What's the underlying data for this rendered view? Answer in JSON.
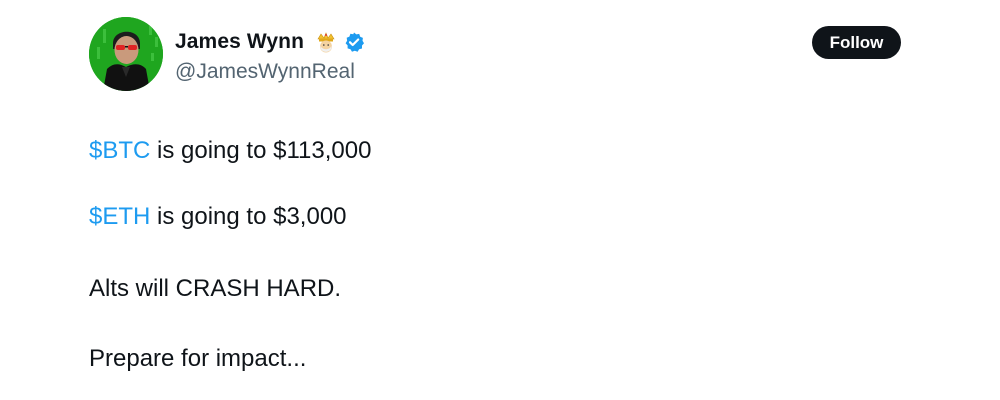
{
  "author": {
    "display_name": "James Wynn",
    "handle": "@JamesWynnReal",
    "badge_emoji": "king-emoji",
    "verified_icon": "verified-badge-icon",
    "avatar_icon": "matrix-avatar-icon"
  },
  "follow_button": {
    "label": "Follow"
  },
  "tweet": {
    "line1": {
      "cashtag": "$BTC",
      "text": " is going to $113,000"
    },
    "line2": {
      "cashtag": "$ETH",
      "text": " is going to $3,000"
    },
    "line3": "Alts will CRASH HARD.",
    "line4": "Prepare for impact..."
  },
  "colors": {
    "link": "#1d9bf0",
    "text": "#0f1419",
    "muted": "#536471",
    "verified": "#1d9bf0",
    "follow_bg": "#0f1419",
    "avatar_bg": "#1fa61f"
  }
}
